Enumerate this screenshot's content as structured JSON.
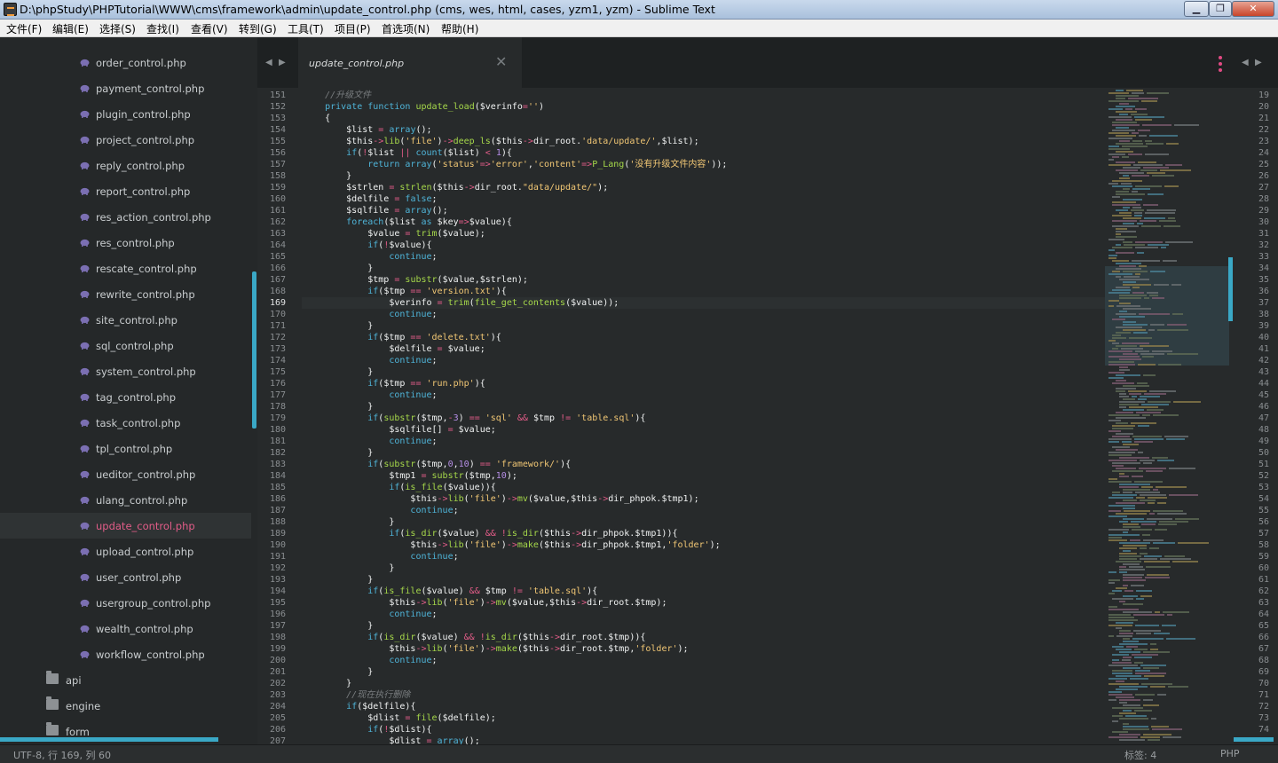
{
  "window": {
    "title": "D:\\phpStudy\\PHPTutorial\\WWW\\cms\\framework\\admin\\update_control.php (cms, wes, html, cases, yzm1, yzm) - Sublime Text",
    "minimize": "▁",
    "maximize": "❐",
    "close": "✕"
  },
  "menu": [
    "文件(F)",
    "编辑(E)",
    "选择(S)",
    "查找(I)",
    "查看(V)",
    "转到(G)",
    "工具(T)",
    "项目(P)",
    "首选项(N)",
    "帮助(H)"
  ],
  "sidebar": {
    "files": [
      "order_control.php",
      "payment_control.php",
      "plugin_control.php",
      "project_control.php",
      "reply_control.php",
      "report_control.php",
      "res_action_control.php",
      "res_control.php",
      "rescate_control.php",
      "rewrite_control.php",
      "site_control.php",
      "sql_control.php",
      "system_control.php",
      "tag_control.php",
      "task_control.php",
      "tpl_control.php",
      "ueditor_control.php",
      "ulang_control.php",
      "update_control.php",
      "upload_control.php",
      "user_control.php",
      "usergroup_control.php",
      "wealth_control.php",
      "workflow_control.php"
    ],
    "active_file": "update_control.php",
    "folders": [
      "api",
      "engine",
      "form"
    ],
    "file_icon": "php-elephant-icon",
    "folder_icon": "folder-icon"
  },
  "tab": {
    "label": "update_control.php",
    "close": "✕"
  },
  "nav": {
    "left": "◀",
    "right": "▶"
  },
  "editor": {
    "first_line": 151,
    "current_line": 169,
    "lines": [
      "    //升级文件",
      "    private function update_load($verinfo='')",
      "    {",
      "        $list = array();",
      "        $this->lib('file')->deep_ls($this->dir_root.'data/update/',$list);",
      "        if(!$list || count($list) < 1){",
      "            return array('status'=>'error','content'=>P_Lang('没有升级文件内容'));",
      "        }",
      "        $strlen = strlen($this->dir_root.\"data/update/\");",
      "        $delfile = false;",
      "        $sqlfile = array();",
      "        foreach($list as $key=>$value){",
      "            $value = trim($value);",
      "            if(!$value){",
      "                continue;",
      "            }",
      "            $tmp = substr($value,$strlen);",
      "            if($tmp == 'version.txt'){",
      "                $verinfo = trim(file_get_contents($value));",
      "                continue;",
      "            }",
      "            if($tmp == 'delete.txt'){",
      "                $delfile = $value;",
      "                continue;",
      "            }",
      "            if($tmp == 'run.php'){",
      "                continue;",
      "            }",
      "            if(substr($tmp,-3) == 'sql' && $tmp != 'table.sql'){",
      "                $sqlfile[] = $value;",
      "                continue;",
      "            }",
      "            if(substr($tmp,0,10) == 'framework/'){",
      "                $tmp1 = substr($tmp,10);",
      "                if(is_file($value)){",
      "                    $this->lib('file')->mv($value,$this->dir_phpok.$tmp1);",
      "                    continue;",
      "                }",
      "                if(is_dir($value) && !is_dir($this->dir_phpok.$tmp1)){",
      "                    $this->lib('file')->make($this->dir_phpok.$tmp1,'folder');",
      "                    continue;",
      "                }",
      "            }",
      "            if(is_file($value) && $tmp != 'table.sql'){",
      "                $this->lib('file')->mv($value,$this->dir_root.$tmp);",
      "                continue;",
      "            }",
      "            if(is_dir($value) && !is_dir($this->dir_root.$tmp)){",
      "                $this->lib('file')->make($this->dir_root.$tmp,'folder');",
      "                continue;",
      "            }",
      "        }",
      "        //现在执行删除",
      "        if($delfile){",
      "            $dlist = file($delfile);",
      "            if(!$dlist){",
      "                $dlist = array();"
    ]
  },
  "right_pane": {
    "first_line": 19,
    "last_line": 74
  },
  "status": {
    "left": "UTF-8, 行 169, 列 60",
    "tab_size": "标签: 4",
    "syntax": "PHP"
  },
  "colors": {
    "background": "#272a2b",
    "accent": "#3aa8c6",
    "keyword": "#4fb4d8",
    "function": "#a6d84a",
    "string": "#f0c674",
    "operator": "#e25c88",
    "active_file": "#e25c88"
  }
}
